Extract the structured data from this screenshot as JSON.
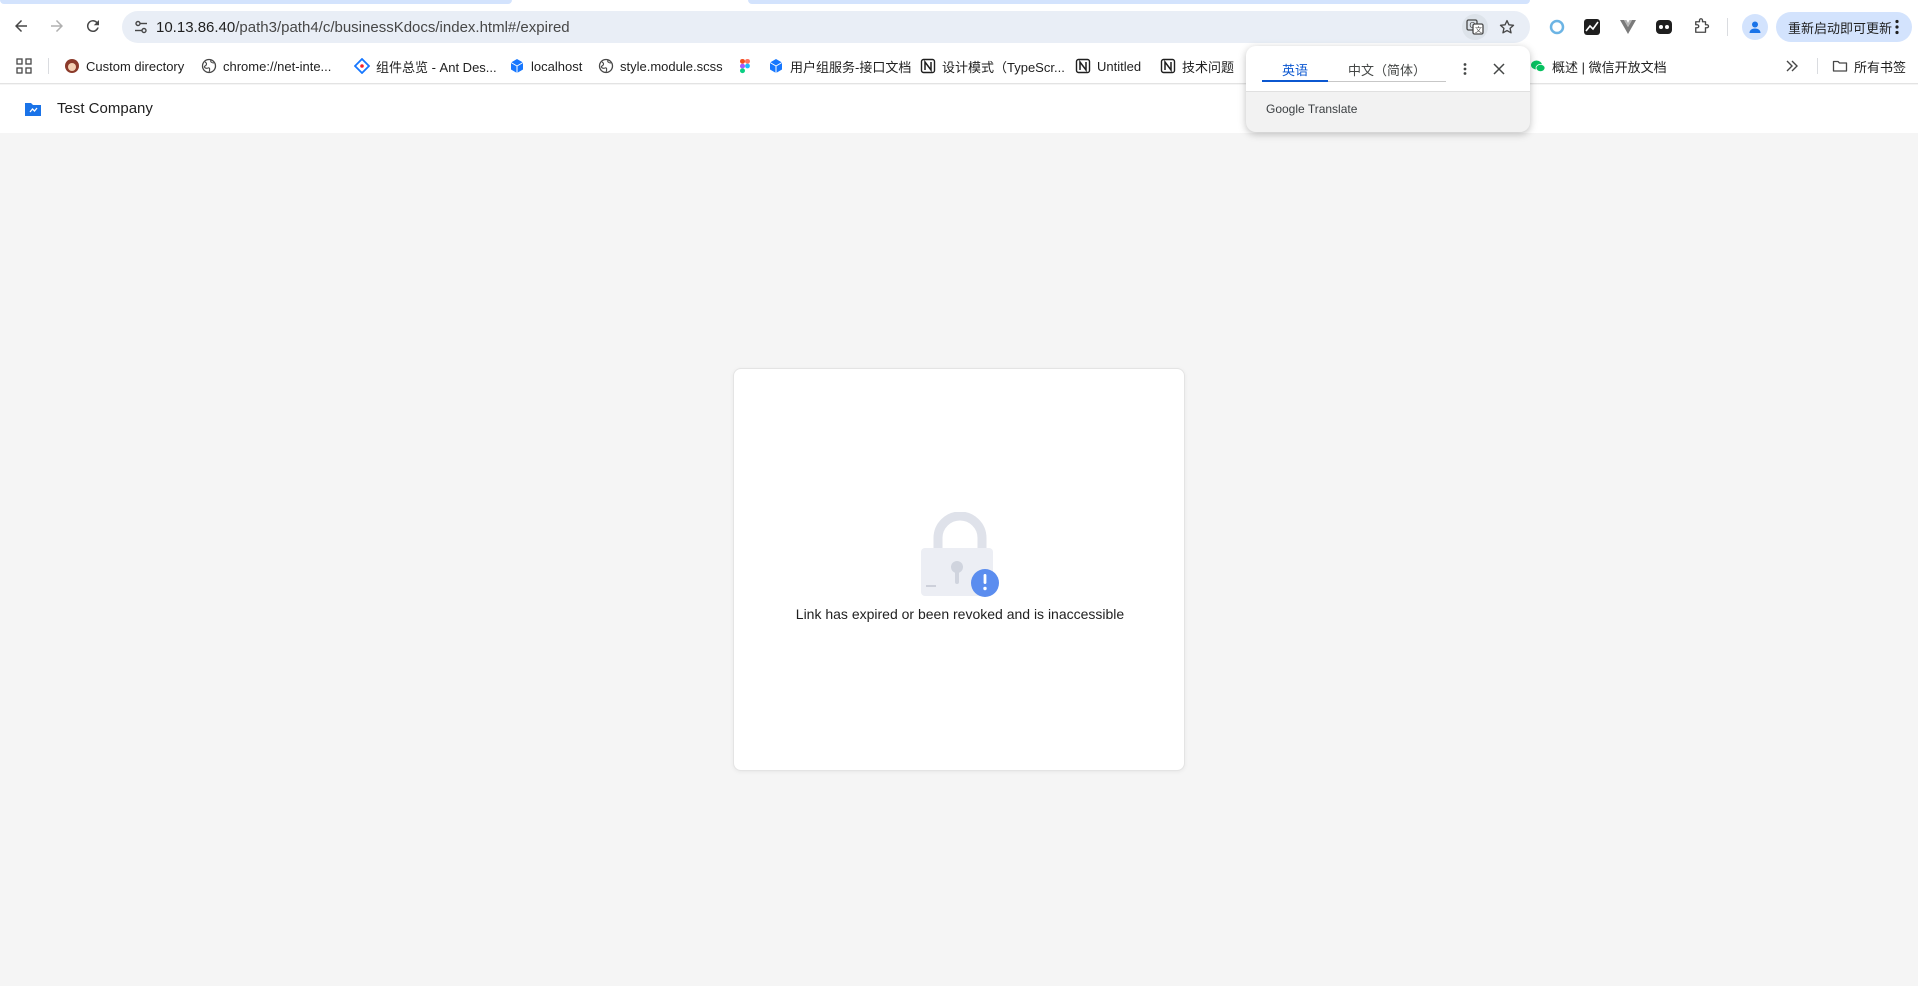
{
  "browser": {
    "address_bar": {
      "host": "10.13.86.40",
      "path": "/path3/path4/c/businessKdocs/index.html#/expired"
    },
    "update_button": "重新启动即可更新",
    "bookmarks": [
      {
        "label": "Custom directory",
        "icon": "avatar-icon"
      },
      {
        "label": "chrome://net-inte...",
        "icon": "globe-icon"
      },
      {
        "label": "组件总览 - Ant Des...",
        "icon": "ant-design-icon"
      },
      {
        "label": "localhost",
        "icon": "cube-icon"
      },
      {
        "label": "style.module.scss",
        "icon": "globe-icon"
      },
      {
        "label": "",
        "icon": "figma-icon"
      },
      {
        "label": "用户组服务-接口文档",
        "icon": "cube-icon"
      },
      {
        "label": "设计模式（TypeScr...",
        "icon": "notion-icon"
      },
      {
        "label": "Untitled",
        "icon": "notion-icon"
      },
      {
        "label": "技术问题",
        "icon": "notion-icon"
      },
      {
        "label": "概述 | 微信开放文档",
        "icon": "wechat-icon"
      }
    ],
    "all_bookmarks": "所有书签"
  },
  "translate_popup": {
    "tabs": [
      "英语",
      "中文（简体）"
    ],
    "active_tab": 0,
    "brand_google": "Google",
    "brand_translate": "Translate"
  },
  "app": {
    "company": "Test Company",
    "message": "Link has expired or been revoked and is inaccessible"
  },
  "colors": {
    "page_bg": "#f5f5f5",
    "accent_blue": "#0b57d0",
    "lock_badge": "#5b8def"
  }
}
